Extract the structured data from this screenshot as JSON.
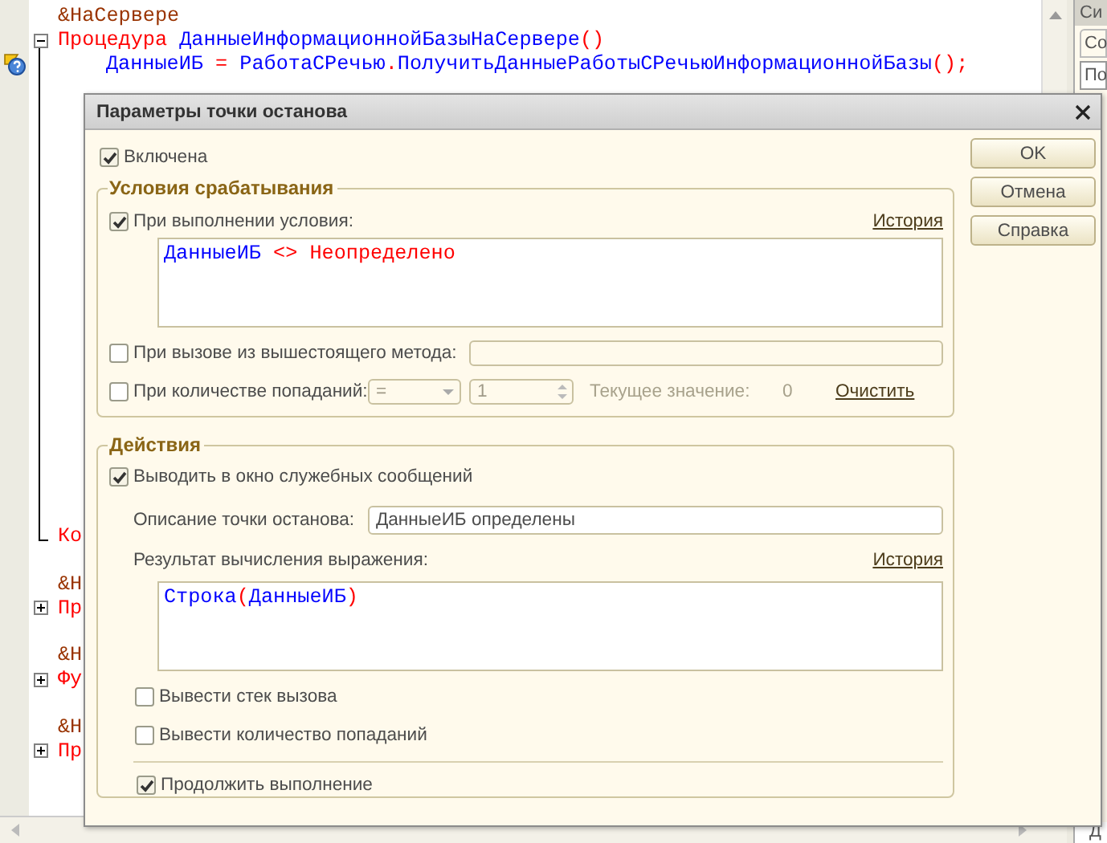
{
  "editor": {
    "blocks": [
      {
        "directive": [
          {
            "text": "&НаСервере",
            "kind": "directive"
          }
        ],
        "header": [
          {
            "text": "Процедура ",
            "kind": "keyword"
          },
          {
            "text": "ДанныеИнформационнойБазыНаСервере",
            "kind": "identifier"
          },
          {
            "text": "()",
            "kind": "operator"
          }
        ],
        "expanded": true,
        "body": [
          {
            "breakpoint": true,
            "tokens": [
              {
                "text": "ДанныеИБ ",
                "kind": "identifier"
              },
              {
                "text": "= ",
                "kind": "operator"
              },
              {
                "text": "РаботаСРечью",
                "kind": "identifier"
              },
              {
                "text": ".",
                "kind": "operator"
              },
              {
                "text": "ПолучитьДанныеРаботыСРечьюИнформационнойБазы",
                "kind": "identifier"
              },
              {
                "text": "();",
                "kind": "operator"
              }
            ]
          }
        ],
        "end": [
          {
            "text": "Ко",
            "kind": "keyword"
          }
        ]
      },
      {
        "directive": [
          {
            "text": "&Н",
            "kind": "directive"
          }
        ],
        "header": [
          {
            "text": "Пр",
            "kind": "keyword"
          }
        ],
        "expanded": false
      },
      {
        "directive": [
          {
            "text": "&Н",
            "kind": "directive"
          }
        ],
        "header": [
          {
            "text": "Фу",
            "kind": "keyword"
          }
        ],
        "expanded": false
      },
      {
        "directive": [
          {
            "text": "&Н",
            "kind": "directive"
          }
        ],
        "header": [
          {
            "text": "Пр",
            "kind": "keyword"
          }
        ],
        "expanded": false
      }
    ]
  },
  "side_panel": {
    "header": "Си",
    "tab": "Со",
    "field": "По",
    "corner": "Д"
  },
  "dialog": {
    "title": "Параметры точки останова",
    "enabled": {
      "label": "Включена",
      "checked": true
    },
    "buttons": [
      "OK",
      "Отмена",
      "Справка"
    ],
    "conditions": {
      "title": "Условия срабатывания",
      "on_condition": {
        "label": "При выполнении условия:",
        "checked": true
      },
      "history_link": "История",
      "condition_code": [
        {
          "text": "ДанныеИБ ",
          "kind": "identifier"
        },
        {
          "text": "<> ",
          "kind": "operator"
        },
        {
          "text": "Неопределено",
          "kind": "keyword"
        }
      ],
      "on_caller": {
        "label": "При вызове из вышестоящего метода:",
        "checked": false
      },
      "caller_field": {
        "disabled": true
      },
      "on_hit_count": {
        "label": "При количестве попаданий:",
        "checked": false
      },
      "compare": {
        "value": "=",
        "disabled": true
      },
      "count": {
        "value": "1",
        "disabled": true
      },
      "current_label": "Текущее значение:",
      "current_value": "0",
      "clear_link": "Очистить"
    },
    "actions": {
      "title": "Действия",
      "output_messages": {
        "label": "Выводить в окно служебных сообщений",
        "checked": true
      },
      "description_label": "Описание точки останова:",
      "description_value": "ДанныеИБ определены",
      "result_label": "Результат вычисления выражения:",
      "history_link": "История",
      "result_code": [
        {
          "text": "Строка",
          "kind": "identifier"
        },
        {
          "text": "(",
          "kind": "operator"
        },
        {
          "text": "ДанныеИБ",
          "kind": "identifier"
        },
        {
          "text": ")",
          "kind": "operator"
        }
      ],
      "print_stack": {
        "label": "Вывести стек вызова",
        "checked": false
      },
      "print_hits": {
        "label": "Вывести количество попаданий",
        "checked": false
      },
      "continue": {
        "label": "Продолжить выполнение",
        "checked": true
      }
    }
  }
}
